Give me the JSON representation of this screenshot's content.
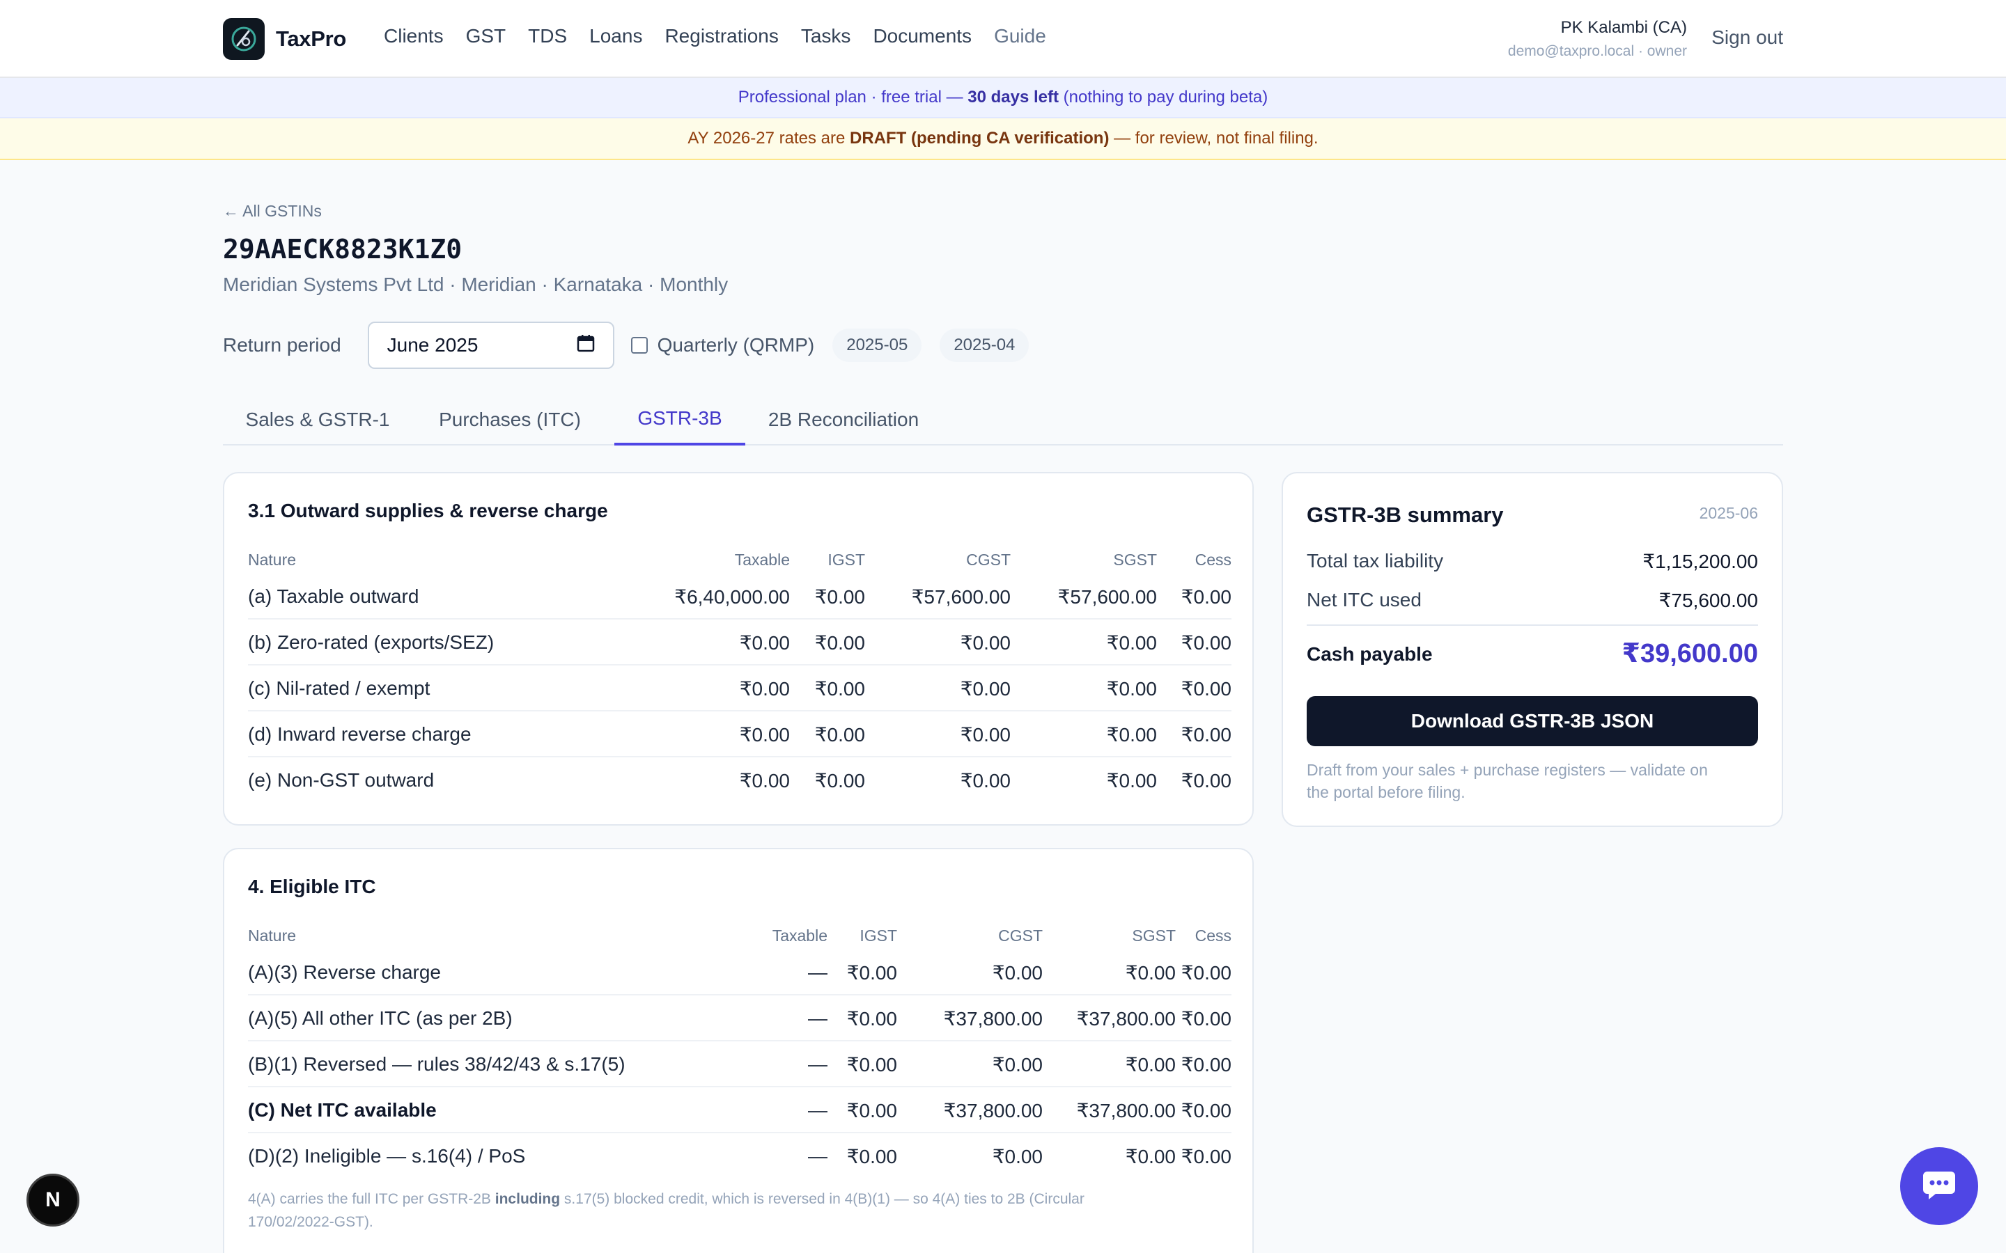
{
  "nav": {
    "brand": "TaxPro",
    "links": [
      "Clients",
      "GST",
      "TDS",
      "Loans",
      "Registrations",
      "Tasks",
      "Documents",
      "Guide"
    ],
    "user_name": "PK Kalambi (CA)",
    "user_sub": "demo@taxpro.local · owner",
    "signout": "Sign out"
  },
  "banners": {
    "trial_prefix": "Professional plan · free trial — ",
    "trial_bold": "30 days left",
    "trial_suffix": " (nothing to pay during beta)",
    "draft_prefix": "AY 2026-27 rates are ",
    "draft_bold": "DRAFT (pending CA verification)",
    "draft_suffix": " — for review, not final filing."
  },
  "header": {
    "back": "← All GSTINs",
    "gstin": "29AAECK8823K1Z0",
    "subtitle": "Meridian Systems Pvt Ltd · Meridian · Karnataka · Monthly"
  },
  "period": {
    "label": "Return period",
    "value": "June 2025",
    "qrmp_label": "Quarterly (QRMP)",
    "qrmp_checked": false,
    "chips": [
      "2025-05",
      "2025-04"
    ]
  },
  "tabs": [
    "Sales & GSTR-1",
    "Purchases (ITC)",
    "GSTR-3B",
    "2B Reconciliation"
  ],
  "active_tab": "GSTR-3B",
  "outward": {
    "title": "3.1 Outward supplies & reverse charge",
    "columns": [
      "Nature",
      "Taxable",
      "IGST",
      "CGST",
      "SGST",
      "Cess"
    ],
    "rows": [
      [
        "(a) Taxable outward",
        "₹6,40,000.00",
        "₹0.00",
        "₹57,600.00",
        "₹57,600.00",
        "₹0.00"
      ],
      [
        "(b) Zero-rated (exports/SEZ)",
        "₹0.00",
        "₹0.00",
        "₹0.00",
        "₹0.00",
        "₹0.00"
      ],
      [
        "(c) Nil-rated / exempt",
        "₹0.00",
        "₹0.00",
        "₹0.00",
        "₹0.00",
        "₹0.00"
      ],
      [
        "(d) Inward reverse charge",
        "₹0.00",
        "₹0.00",
        "₹0.00",
        "₹0.00",
        "₹0.00"
      ],
      [
        "(e) Non-GST outward",
        "₹0.00",
        "₹0.00",
        "₹0.00",
        "₹0.00",
        "₹0.00"
      ]
    ]
  },
  "itc": {
    "title": "4. Eligible ITC",
    "columns": [
      "Nature",
      "Taxable",
      "IGST",
      "CGST",
      "SGST",
      "Cess"
    ],
    "rows": [
      [
        "(A)(3) Reverse charge",
        "—",
        "₹0.00",
        "₹0.00",
        "₹0.00",
        "₹0.00"
      ],
      [
        "(A)(5) All other ITC (as per 2B)",
        "—",
        "₹0.00",
        "₹37,800.00",
        "₹37,800.00",
        "₹0.00"
      ],
      [
        "(B)(1) Reversed — rules 38/42/43 & s.17(5)",
        "—",
        "₹0.00",
        "₹0.00",
        "₹0.00",
        "₹0.00"
      ],
      [
        "(C) Net ITC available",
        "—",
        "₹0.00",
        "₹37,800.00",
        "₹37,800.00",
        "₹0.00"
      ],
      [
        "(D)(2) Ineligible — s.16(4) / PoS",
        "—",
        "₹0.00",
        "₹0.00",
        "₹0.00",
        "₹0.00"
      ]
    ],
    "bold_row": "(C) Net ITC available",
    "footnote_prefix": "4(A) carries the full ITC per GSTR-2B ",
    "footnote_bold": "including",
    "footnote_line1_suffix": " s.17(5) blocked credit, which is reversed in 4(B)(1) — so 4(A) ties to 2B (Circular",
    "footnote_line2": "170/02/2022-GST)."
  },
  "summary": {
    "title": "GSTR-3B summary",
    "period": "2025-06",
    "total_label": "Total tax liability",
    "total_value": "₹1,15,200.00",
    "itc_label": "Net ITC used",
    "itc_value": "₹75,600.00",
    "cash_label": "Cash payable",
    "cash_value": "₹39,600.00",
    "download": "Download GSTR-3B JSON",
    "note_line1": "Draft from your sales + purchase registers — validate on",
    "note_line2": "the portal before filing."
  },
  "floating": {
    "next_badge": "N"
  },
  "colors": {
    "accent": "#4f46e5",
    "accent_text": "#4338ca",
    "button_dark": "#0f172a",
    "draft_bg": "#fefce8",
    "trial_bg": "#eef2ff"
  }
}
